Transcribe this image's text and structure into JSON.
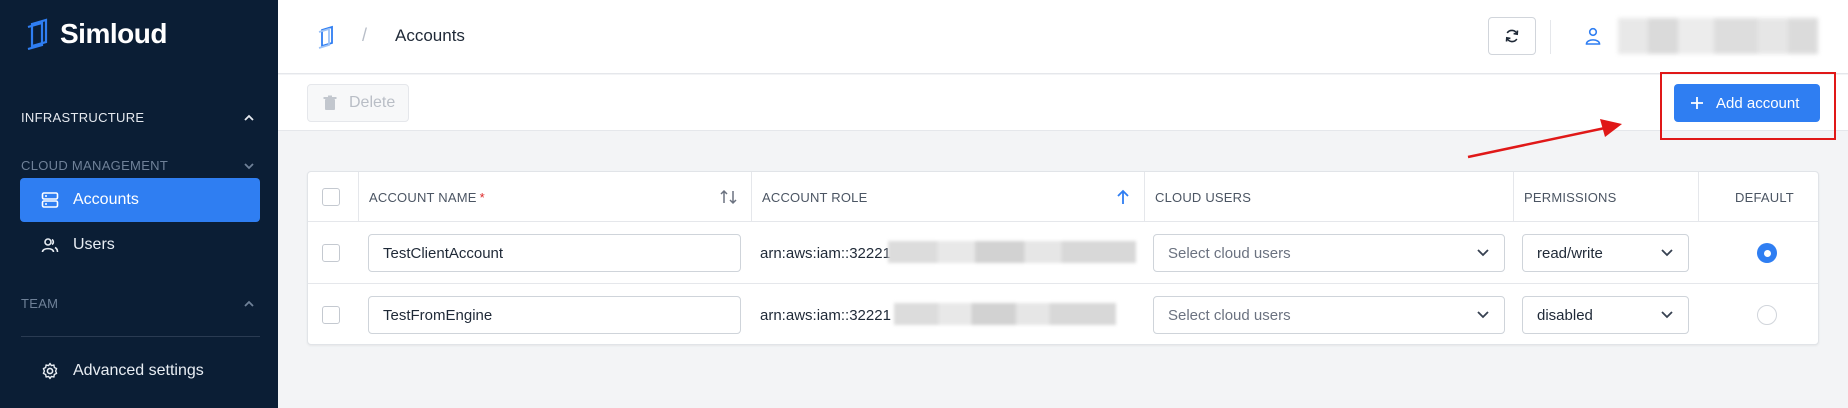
{
  "brand": {
    "name": "Simloud"
  },
  "sidebar": {
    "sections": [
      {
        "label": "INFRASTRUCTURE"
      },
      {
        "label": "CLOUD MANAGEMENT"
      },
      {
        "label": "TEAM"
      }
    ],
    "items": [
      {
        "label": "Accounts",
        "icon": "server-icon",
        "active": true
      },
      {
        "label": "Users",
        "icon": "users-icon",
        "active": false
      },
      {
        "label": "Advanced settings",
        "icon": "gear-icon",
        "active": false
      }
    ]
  },
  "header": {
    "title": "Accounts",
    "breadcrumb_separator": "/"
  },
  "toolbar": {
    "delete_label": "Delete",
    "add_label": "Add account"
  },
  "table": {
    "columns": [
      "ACCOUNT NAME",
      "ACCOUNT ROLE",
      "CLOUD USERS",
      "PERMISSIONS",
      "DEFAULT"
    ],
    "required_mark": "*",
    "rows": [
      {
        "name": "TestClientAccount",
        "role": "arn:aws:iam::32221",
        "cloud_users_placeholder": "Select cloud users",
        "permission": "read/write",
        "default": true
      },
      {
        "name": "TestFromEngine",
        "role": "arn:aws:iam::32221",
        "cloud_users_placeholder": "Select cloud users",
        "permission": "disabled",
        "default": false
      }
    ]
  },
  "colors": {
    "accent": "#2f7ef2",
    "sidebar_bg": "#0b1e35",
    "annotation": "#e01818"
  }
}
